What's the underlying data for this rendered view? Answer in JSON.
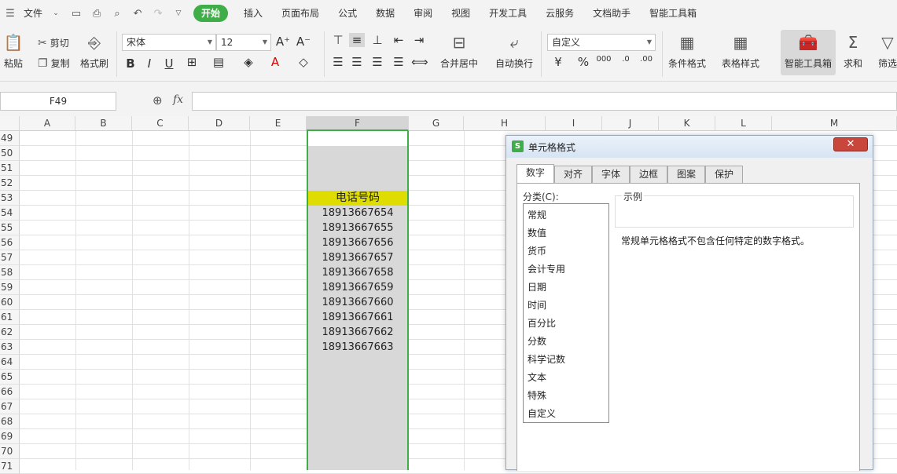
{
  "menubar": {
    "file_label": "文件",
    "tabs": [
      {
        "label": "开始",
        "active": true
      },
      {
        "label": "插入"
      },
      {
        "label": "页面布局"
      },
      {
        "label": "公式"
      },
      {
        "label": "数据"
      },
      {
        "label": "审阅"
      },
      {
        "label": "视图"
      },
      {
        "label": "开发工具"
      },
      {
        "label": "云服务"
      },
      {
        "label": "文档助手"
      },
      {
        "label": "智能工具箱"
      }
    ]
  },
  "ribbon": {
    "paste": "粘贴",
    "cut": "剪切",
    "copy": "复制",
    "format_painter": "格式刷",
    "font_name": "宋体",
    "font_size": "12",
    "bold": "B",
    "italic": "I",
    "underline": "U",
    "merge_center": "合并居中",
    "wrap": "自动换行",
    "number_format": "自定义",
    "cond_format": "条件格式",
    "table_style": "表格样式",
    "smart_toolbox": "智能工具箱",
    "sum": "求和",
    "filter": "筛选"
  },
  "formula": {
    "cell_ref": "F49",
    "fx": "fx"
  },
  "columns": [
    "A",
    "B",
    "C",
    "D",
    "E",
    "F",
    "G",
    "H",
    "I",
    "J",
    "K",
    "L",
    "M"
  ],
  "rows": [
    "49",
    "50",
    "51",
    "52",
    "53",
    "54",
    "55",
    "56",
    "57",
    "58",
    "59",
    "60",
    "61",
    "62",
    "63",
    "64",
    "65",
    "66",
    "67",
    "68",
    "69",
    "70",
    "71"
  ],
  "cells_f": {
    "header": "电话号码",
    "values": [
      "18913667654",
      "18913667655",
      "18913667656",
      "18913667657",
      "18913667658",
      "18913667659",
      "18913667660",
      "18913667661",
      "18913667662",
      "18913667663"
    ]
  },
  "dialog": {
    "title": "单元格格式",
    "close": "✕",
    "tabs": [
      "数字",
      "对齐",
      "字体",
      "边框",
      "图案",
      "保护"
    ],
    "category_label": "分类(C):",
    "categories": [
      "常规",
      "数值",
      "货币",
      "会计专用",
      "日期",
      "时间",
      "百分比",
      "分数",
      "科学记数",
      "文本",
      "特殊",
      "自定义"
    ],
    "sample_label": "示例",
    "description": "常规单元格格式不包含任何特定的数字格式。"
  },
  "colors": {
    "accent": "#3fae49",
    "header_fill": "#dedc00",
    "selection": "#d8d8d8"
  }
}
